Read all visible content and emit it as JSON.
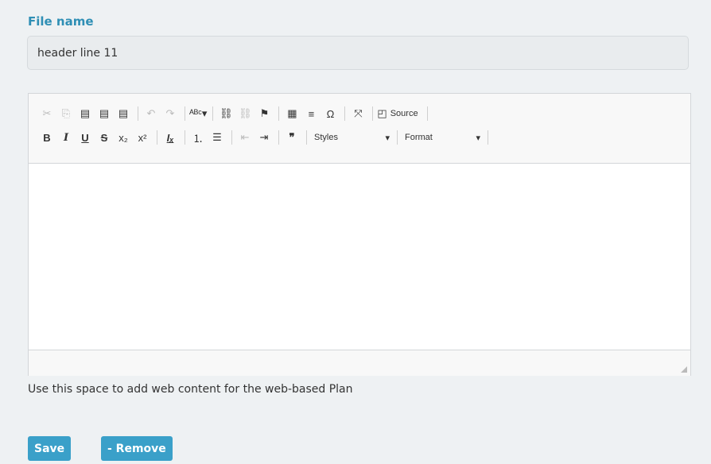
{
  "form": {
    "file_label": "File name",
    "file_value": "header line 11",
    "help_text": "Use this space to add web content for the web-based Plan"
  },
  "toolbar": {
    "row1": [
      {
        "name": "cut-icon",
        "glyph": "✂",
        "disabled": true
      },
      {
        "name": "copy-icon",
        "glyph": "⎘",
        "disabled": true
      },
      {
        "name": "paste-icon",
        "glyph": "▤"
      },
      {
        "name": "paste-text-icon",
        "glyph": "▤"
      },
      {
        "name": "paste-word-icon",
        "glyph": "▤"
      },
      {
        "sep": true
      },
      {
        "name": "undo-icon",
        "glyph": "↶",
        "disabled": true
      },
      {
        "name": "redo-icon",
        "glyph": "↷",
        "disabled": true
      },
      {
        "sep": true
      },
      {
        "name": "spellcheck-icon",
        "glyph": "ᴬᴮᶜ▾"
      },
      {
        "sep": true
      },
      {
        "name": "link-icon",
        "glyph": "⛓"
      },
      {
        "name": "unlink-icon",
        "glyph": "⛓",
        "disabled": true
      },
      {
        "name": "anchor-flag-icon",
        "glyph": "⚑"
      },
      {
        "sep": true
      },
      {
        "name": "table-icon",
        "glyph": "▦"
      },
      {
        "name": "horizontal-line-icon",
        "glyph": "≡"
      },
      {
        "name": "special-char-icon",
        "glyph": "Ω"
      },
      {
        "sep": true
      },
      {
        "name": "maximize-icon",
        "glyph": "⤧"
      },
      {
        "sep": true
      },
      {
        "name": "source-icon",
        "glyph": "◰",
        "label": "Source"
      },
      {
        "sep": true
      }
    ],
    "row2": [
      {
        "name": "bold-icon",
        "glyph": "B"
      },
      {
        "name": "italic-icon",
        "glyph": "I"
      },
      {
        "name": "underline-icon",
        "glyph": "U"
      },
      {
        "name": "strike-icon",
        "glyph": "S"
      },
      {
        "name": "subscript-icon",
        "glyph": "x₂"
      },
      {
        "name": "superscript-icon",
        "glyph": "x²"
      },
      {
        "sep": true
      },
      {
        "name": "remove-format-icon",
        "glyph": "Iₓ"
      },
      {
        "sep": true
      },
      {
        "name": "numbered-list-icon",
        "glyph": "⒈"
      },
      {
        "name": "bullet-list-icon",
        "glyph": "☰"
      },
      {
        "sep": true
      },
      {
        "name": "outdent-icon",
        "glyph": "⇤",
        "disabled": true
      },
      {
        "name": "indent-icon",
        "glyph": "⇥"
      },
      {
        "sep": true
      },
      {
        "name": "blockquote-icon",
        "glyph": "❞"
      },
      {
        "sep": true
      }
    ],
    "styles_label": "Styles",
    "format_label": "Format"
  },
  "buttons": {
    "save": "Save",
    "remove": "- Remove"
  }
}
